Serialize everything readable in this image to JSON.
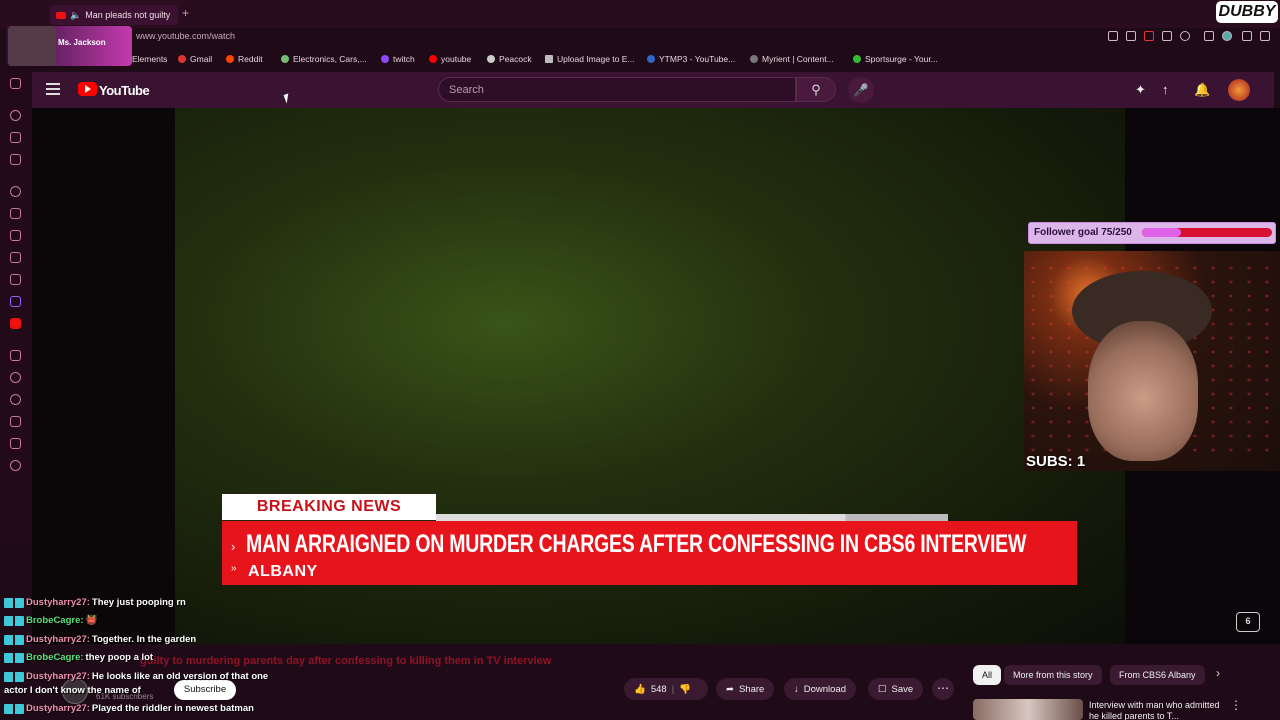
{
  "browser": {
    "tab_title": "Man pleads not guilty",
    "url": "www.youtube.com/watch",
    "overlay_brand": "DUBBY",
    "stream_badge": "Ms. Jackson",
    "bookmarks": [
      "Elements",
      "Gmail",
      "Reddit",
      "Electronics, Cars,...",
      "twitch",
      "youtube",
      "Peacock",
      "Upload Image to E...",
      "YTMP3 - YouTube...",
      "Myrient | Content...",
      "Sportsurge - Your..."
    ]
  },
  "youtube": {
    "brand": "YouTube",
    "search_placeholder": "Search",
    "video_title": "guilty to murdering parents day after confessing to killing them in TV interview",
    "subscribe_label": "Subscribe",
    "subscriber_count": "61K subscribers",
    "actions": {
      "like_count": "548",
      "share": "Share",
      "download": "Download",
      "save": "Save"
    },
    "chips": [
      "All",
      "More from this story",
      "From CBS6 Albany"
    ],
    "recommended_title": "Interview with man who admitted he killed parents to T..."
  },
  "video": {
    "banner_label": "BREAKING NEWS",
    "headline": "MAN ARRAIGNED ON MURDER CHARGES AFTER CONFESSING IN CBS6 INTERVIEW",
    "location": "ALBANY",
    "logo": "6"
  },
  "stream": {
    "follower_goal": "Follower goal 75/250",
    "follower_goal_fraction": 0.3,
    "subs_label": "SUBS: 1"
  },
  "chat": [
    {
      "user": "Dustyharry27:",
      "msg": "They just pooping rn",
      "color": "u1"
    },
    {
      "user": "BrobeCagre:",
      "msg": "👹",
      "color": "u2"
    },
    {
      "user": "Dustyharry27:",
      "msg": "Together. In the garden",
      "color": "u1"
    },
    {
      "user": "BrobeCagre:",
      "msg": "they poop a lot",
      "color": "u2"
    },
    {
      "user": "Dustyharry27:",
      "msg": "He looks like an old version of that one",
      "color": "u1"
    },
    {
      "user": "",
      "msg": "actor I don't know the name of",
      "color": "u1"
    },
    {
      "user": "Dustyharry27:",
      "msg": "Played the riddler in newest batman",
      "color": "u1"
    }
  ]
}
